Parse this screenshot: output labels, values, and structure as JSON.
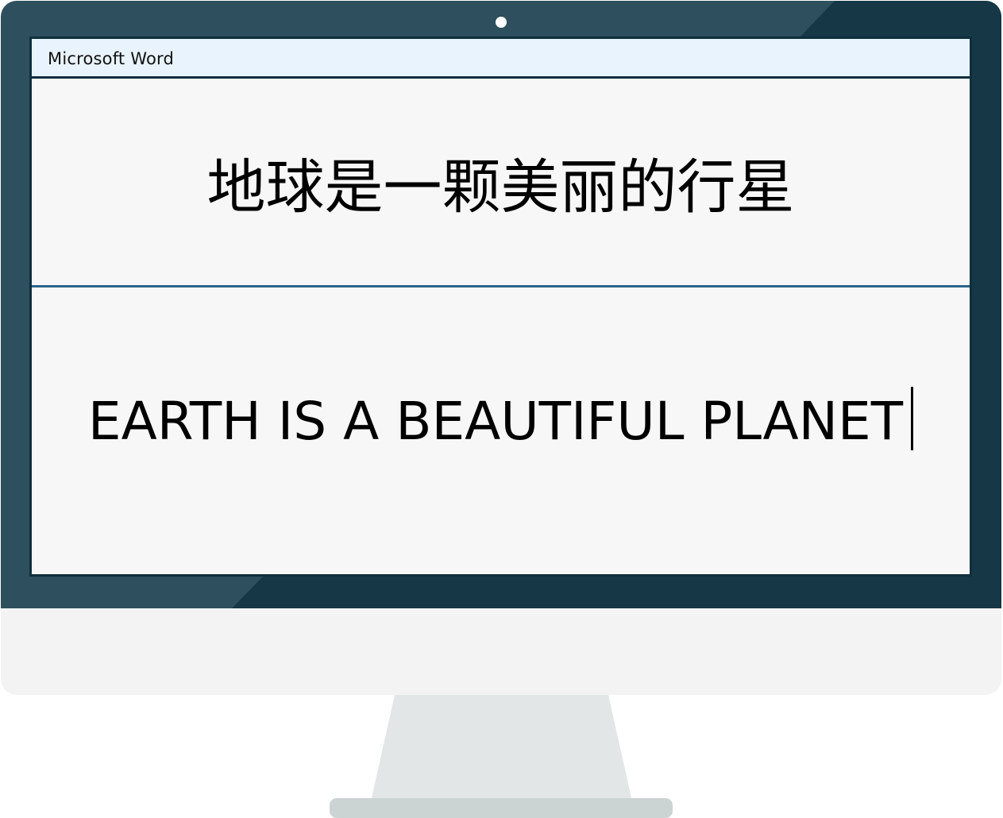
{
  "window": {
    "app_title": "Microsoft Word"
  },
  "document": {
    "line_chinese": "地球是一颗美丽的行星",
    "line_english": "EARTH IS A BEAUTIFUL PLANET"
  },
  "colors": {
    "bezel": "#2e4f5d",
    "bezel_shadow": "#163746",
    "titlebar_bg": "#e9f3fd",
    "page_bg": "#f7f7f7",
    "divider": "#2a6587",
    "chin": "#f3f3f3",
    "stand": "#e2e6e6"
  },
  "icons": {
    "camera": "camera-icon",
    "caret": "text-cursor"
  }
}
